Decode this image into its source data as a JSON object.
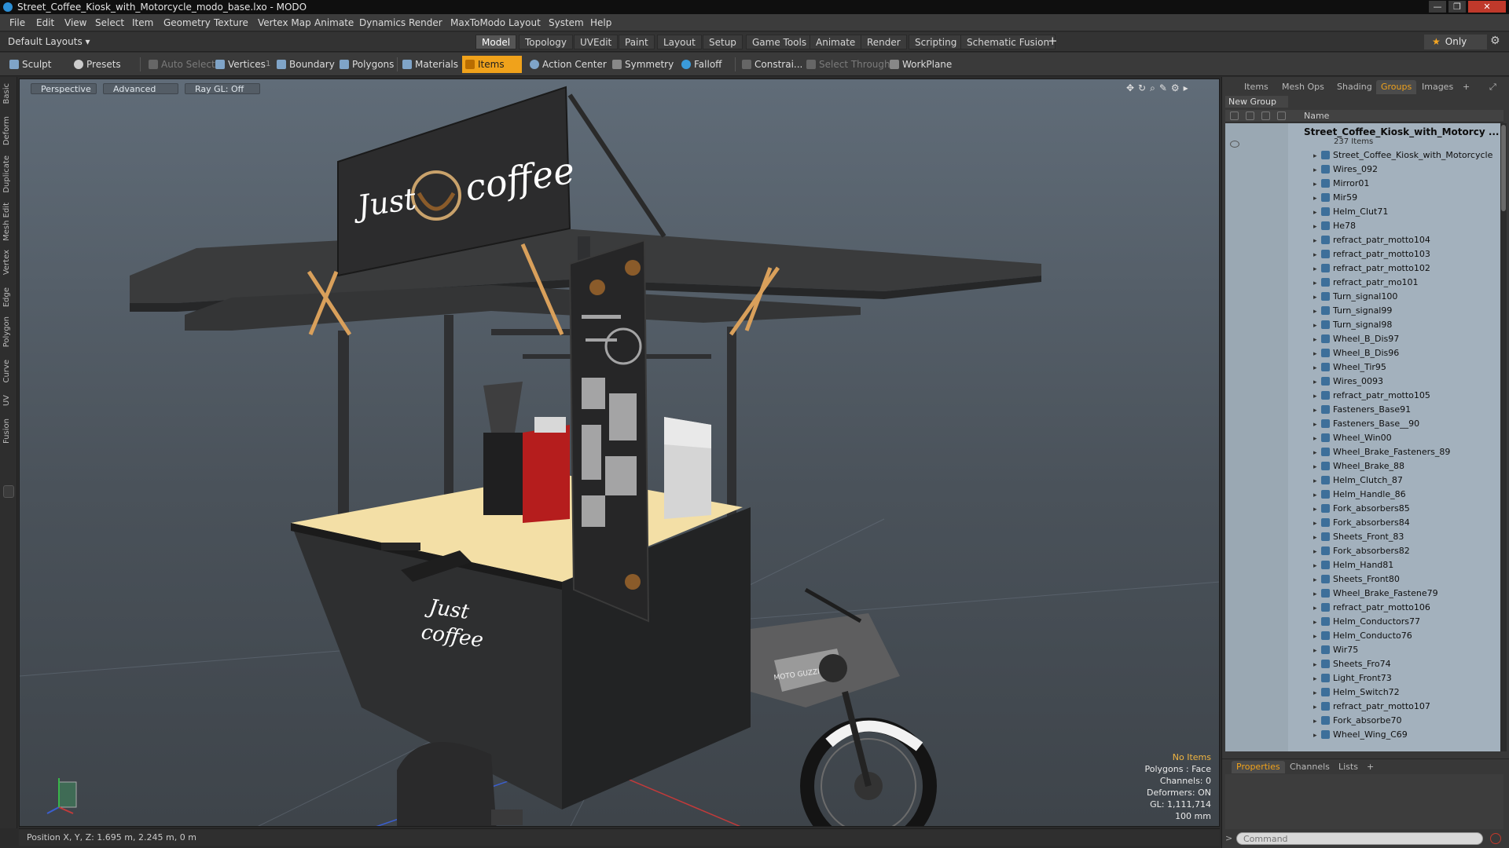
{
  "window": {
    "title": "Street_Coffee_Kiosk_with_Motorcycle_modo_base.lxo - MODO",
    "controls": [
      "—",
      "❐",
      "✕"
    ]
  },
  "menu": [
    "File",
    "Edit",
    "View",
    "Select",
    "Item",
    "Geometry",
    "Texture",
    "Vertex Map",
    "Animate",
    "Dynamics",
    "Render",
    "MaxToModo",
    "Layout",
    "System",
    "Help"
  ],
  "modebar": {
    "layouts_label": "Default Layouts ▾",
    "tabs": [
      "Model",
      "Topology",
      "UVEdit",
      "Paint",
      "Layout",
      "Setup",
      "Game Tools",
      "Animate",
      "Render",
      "Scripting",
      "Schematic Fusion"
    ],
    "active_tab": "Model",
    "only_label": "Only"
  },
  "toolbar": {
    "sculpt": "Sculpt",
    "presets": "Presets",
    "auto_select": "Auto Select",
    "vertices": "Vertices",
    "vertices_count": "1",
    "boundary": "Boundary",
    "polygons": "Polygons",
    "materials": "Materials",
    "items": "Items",
    "action_center": "Action Center",
    "symmetry": "Symmetry",
    "falloff": "Falloff",
    "constraints": "Constrai...",
    "select_through": "Select Through",
    "workplane": "WorkPlane"
  },
  "left_tabs": [
    "Basic",
    "Deform",
    "Duplicate",
    "Mesh Edit",
    "Vertex",
    "Edge",
    "Polygon",
    "Curve",
    "UV",
    "Fusion"
  ],
  "viewport": {
    "view_mode": "Perspective",
    "shading": "Advanced",
    "raygl": "Ray GL: Off",
    "sign_text_1": "Just",
    "sign_text_2": "coffee",
    "cart_text_1": "Just",
    "cart_text_2": "coffee",
    "moto_label": "MOTO GUZZI",
    "info": {
      "no_items": "No Items",
      "polygons": "Polygons : Face",
      "channels": "Channels: 0",
      "deformers": "Deformers: ON",
      "gl": "GL: 1,111,714",
      "scale": "100 mm"
    }
  },
  "statusbar": {
    "position": "Position X, Y, Z:   1.695 m, 2.245 m, 0 m"
  },
  "right_panel": {
    "tabs": [
      "Items",
      "Mesh Ops",
      "Shading",
      "Groups",
      "Images",
      "+"
    ],
    "active_tab": "Groups",
    "new_group": "New Group",
    "column_name": "Name",
    "root_item": "Street_Coffee_Kiosk_with_Motorcy ...",
    "root_count": "237 Items",
    "items": [
      "Street_Coffee_Kiosk_with_Motorcycle",
      "Wires_092",
      "Mirror01",
      "Mir59",
      "Helm_Clut71",
      "He78",
      "refract_patr_motto104",
      "refract_patr_motto103",
      "refract_patr_motto102",
      "refract_patr_mo101",
      "Turn_signal100",
      "Turn_signal99",
      "Turn_signal98",
      "Wheel_B_Dis97",
      "Wheel_B_Dis96",
      "Wheel_Tir95",
      "Wires_0093",
      "refract_patr_motto105",
      "Fasteners_Base91",
      "Fasteners_Base__90",
      "Wheel_Win00",
      "Wheel_Brake_Fasteners_89",
      "Wheel_Brake_88",
      "Helm_Clutch_87",
      "Helm_Handle_86",
      "Fork_absorbers85",
      "Fork_absorbers84",
      "Sheets_Front_83",
      "Fork_absorbers82",
      "Helm_Hand81",
      "Sheets_Front80",
      "Wheel_Brake_Fastene79",
      "refract_patr_motto106",
      "Helm_Conductors77",
      "Helm_Conducto76",
      "Wir75",
      "Sheets_Fro74",
      "Light_Front73",
      "Helm_Switch72",
      "refract_patr_motto107",
      "Fork_absorbe70",
      "Wheel_Wing_C69"
    ],
    "bottom_tabs": [
      "Properties",
      "Channels",
      "Lists",
      "+"
    ],
    "active_bottom_tab": "Properties",
    "command_placeholder": "Command"
  },
  "colors": {
    "accent": "#f0a21b",
    "list_bg": "#a3b1bd",
    "cart_body": "#2d2d2d",
    "counter_top": "#f3dfa6"
  }
}
